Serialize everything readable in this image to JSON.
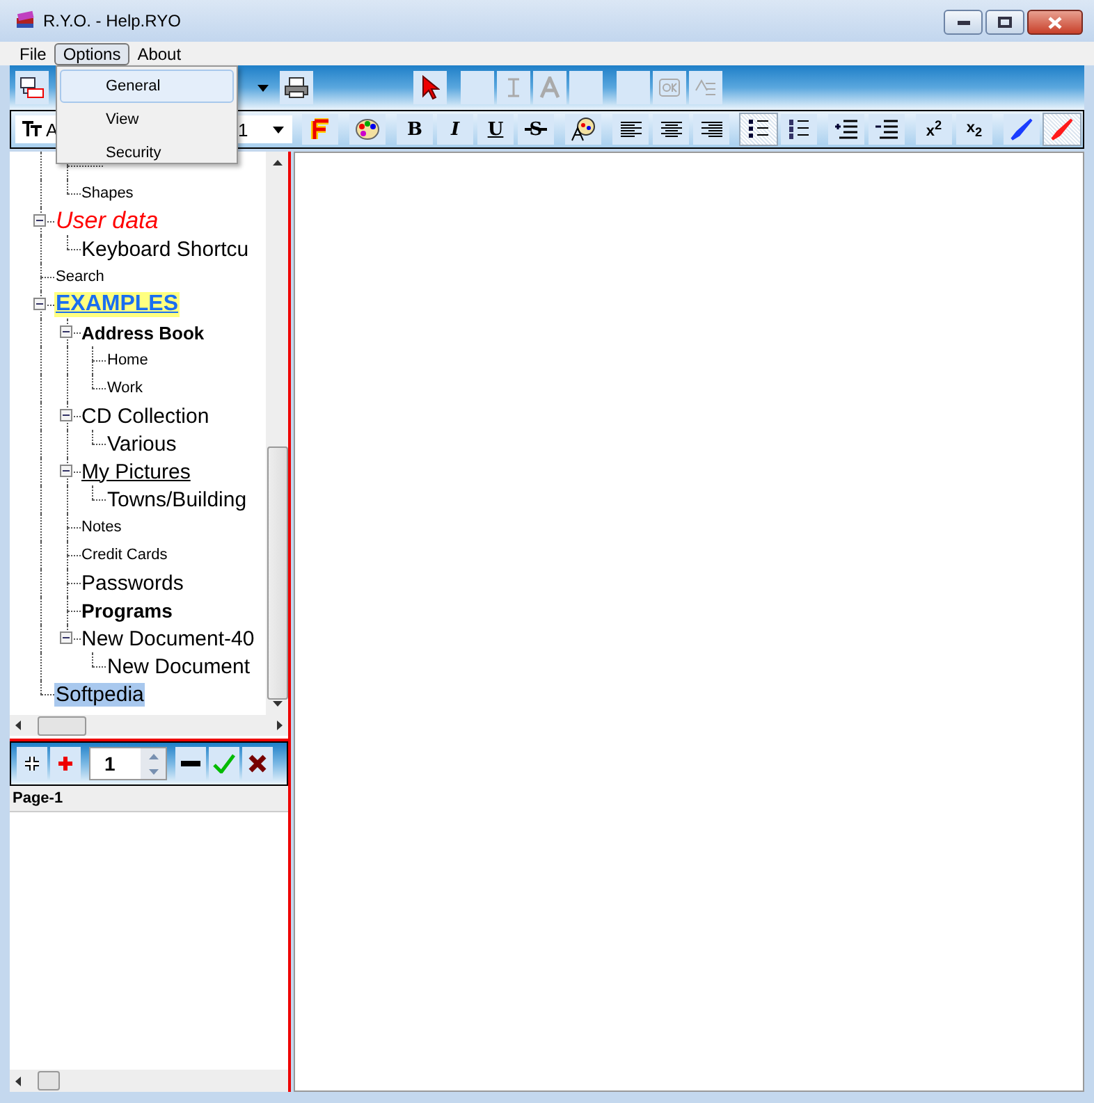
{
  "window": {
    "title": "R.Y.O. - Help.RYO"
  },
  "menu": [
    {
      "label": "File",
      "selected": false
    },
    {
      "label": "Options",
      "selected": true
    },
    {
      "label": "About",
      "selected": false
    }
  ],
  "dropdown": [
    {
      "label": "General",
      "selected": true
    },
    {
      "label": "View",
      "selected": false
    },
    {
      "label": "Security",
      "selected": false
    }
  ],
  "font_field": {
    "value": "A"
  },
  "size_field": {
    "value": "1"
  },
  "format_buttons": [
    {
      "kind": "fontcolor",
      "selected": false
    },
    {
      "kind": "palette",
      "selected": false
    },
    {
      "kind": "bold",
      "label": "B",
      "selected": false
    },
    {
      "kind": "italic",
      "label": "I",
      "selected": false
    },
    {
      "kind": "underline",
      "label": "U",
      "selected": false
    },
    {
      "kind": "strike",
      "label": "S",
      "selected": false
    },
    {
      "kind": "wand",
      "selected": false
    },
    {
      "kind": "alignleft",
      "selected": false
    },
    {
      "kind": "aligncenter",
      "selected": false
    },
    {
      "kind": "alignright",
      "selected": false
    },
    {
      "kind": "bullets",
      "selected": true
    },
    {
      "kind": "numbers",
      "selected": false
    },
    {
      "kind": "indent",
      "selected": false
    },
    {
      "kind": "outdent",
      "selected": false
    },
    {
      "kind": "sup",
      "label": "x$^{2}$",
      "selected": false
    },
    {
      "kind": "sub",
      "label": "x$_{2}$",
      "selected": false
    },
    {
      "kind": "pen",
      "color": "#1a3cff",
      "selected": false
    },
    {
      "kind": "pen",
      "color": "#ff1a1a",
      "selected": true
    }
  ],
  "tree": {
    "scrolled_branch": [
      {
        "label": "Shapes",
        "kind": "small",
        "selected": false
      }
    ],
    "items": [
      {
        "label": "User data",
        "kind": "red",
        "selected": false,
        "expanded": true,
        "children": [
          {
            "label": "Keyboard Shortcu",
            "kind": "large",
            "selected": false
          }
        ]
      },
      {
        "label": "Search",
        "kind": "small",
        "selected": false
      },
      {
        "label": "EXAMPLES",
        "kind": "link",
        "selected": false,
        "expanded": true,
        "children": [
          {
            "label": "Address Book",
            "kind": "bold",
            "selected": false,
            "expanded": true,
            "children": [
              {
                "label": "Home",
                "kind": "small",
                "selected": false
              },
              {
                "label": "Work",
                "kind": "small",
                "selected": false
              }
            ]
          },
          {
            "label": "CD Collection",
            "kind": "large",
            "selected": false,
            "expanded": true,
            "children": [
              {
                "label": "Various",
                "kind": "large",
                "selected": false
              }
            ]
          },
          {
            "label": "My Pictures",
            "kind": "underline",
            "selected": false,
            "expanded": true,
            "children": [
              {
                "label": "Towns/Building",
                "kind": "large",
                "selected": false
              }
            ]
          },
          {
            "label": "Notes",
            "kind": "small",
            "selected": false
          },
          {
            "label": "Credit Cards",
            "kind": "small",
            "selected": false
          },
          {
            "label": "Passwords",
            "kind": "large",
            "selected": false
          },
          {
            "label": "Programs",
            "kind": "bigbold",
            "selected": false
          },
          {
            "label": "New Document-40",
            "kind": "large",
            "selected": false,
            "expanded": true,
            "children": [
              {
                "label": "New Document",
                "kind": "large",
                "selected": false
              }
            ]
          }
        ]
      },
      {
        "label": "Softpedia",
        "kind": "large",
        "selected": true
      }
    ]
  },
  "page_toolbar": {
    "page_number": "1"
  },
  "page_list": {
    "header": "Page-1"
  }
}
